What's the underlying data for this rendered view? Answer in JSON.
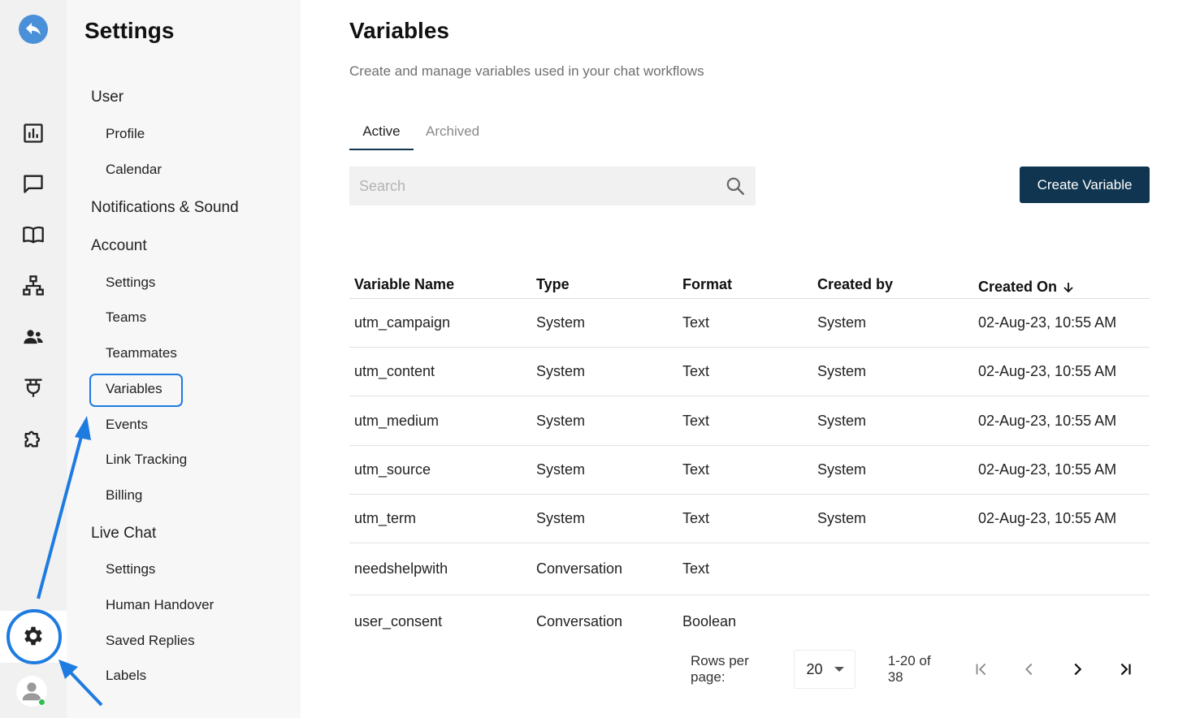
{
  "rail": {
    "icons": [
      "reply-logo-icon",
      "analytics-icon",
      "chat-icon",
      "knowledge-book-icon",
      "org-chart-icon",
      "contacts-icon",
      "integrations-plug-icon",
      "extensions-puzzle-icon",
      "settings-gear-icon",
      "user-avatar-icon"
    ]
  },
  "nav": {
    "title": "Settings",
    "sections": [
      {
        "label": "User",
        "items": [
          "Profile",
          "Calendar"
        ]
      },
      {
        "label": "Notifications & Sound",
        "items": []
      },
      {
        "label": "Account",
        "items": [
          "Settings",
          "Teams",
          "Teammates",
          "Variables",
          "Events",
          "Link Tracking",
          "Billing"
        ]
      },
      {
        "label": "Live Chat",
        "items": [
          "Settings",
          "Human Handover",
          "Saved Replies",
          "Labels"
        ]
      }
    ],
    "active_item": "Variables"
  },
  "main": {
    "title": "Variables",
    "subtitle": "Create and manage variables used in your chat workflows",
    "tabs": [
      {
        "label": "Active",
        "selected": true
      },
      {
        "label": "Archived",
        "selected": false
      }
    ],
    "search": {
      "placeholder": "Search",
      "value": ""
    },
    "create_button": "Create Variable"
  },
  "table": {
    "columns": [
      "Variable Name",
      "Type",
      "Format",
      "Created by",
      "Created On"
    ],
    "rows": [
      [
        "utm_campaign",
        "System",
        "Text",
        "System",
        "02-Aug-23, 10:55 AM"
      ],
      [
        "utm_content",
        "System",
        "Text",
        "System",
        "02-Aug-23, 10:55 AM"
      ],
      [
        "utm_medium",
        "System",
        "Text",
        "System",
        "02-Aug-23, 10:55 AM"
      ],
      [
        "utm_source",
        "System",
        "Text",
        "System",
        "02-Aug-23, 10:55 AM"
      ],
      [
        "utm_term",
        "System",
        "Text",
        "System",
        "02-Aug-23, 10:55 AM"
      ],
      [
        "needshelpwith",
        "Conversation",
        "Text",
        "",
        ""
      ],
      [
        "user_consent",
        "Conversation",
        "Boolean",
        "",
        ""
      ]
    ]
  },
  "pagination": {
    "rows_per_page_label": "Rows per page:",
    "rows_per_page": "20",
    "range": "1-20 of 38"
  },
  "colors": {
    "primary": "#0f3550",
    "annotation": "#1e7be0",
    "status_online": "#2fbf4f"
  }
}
